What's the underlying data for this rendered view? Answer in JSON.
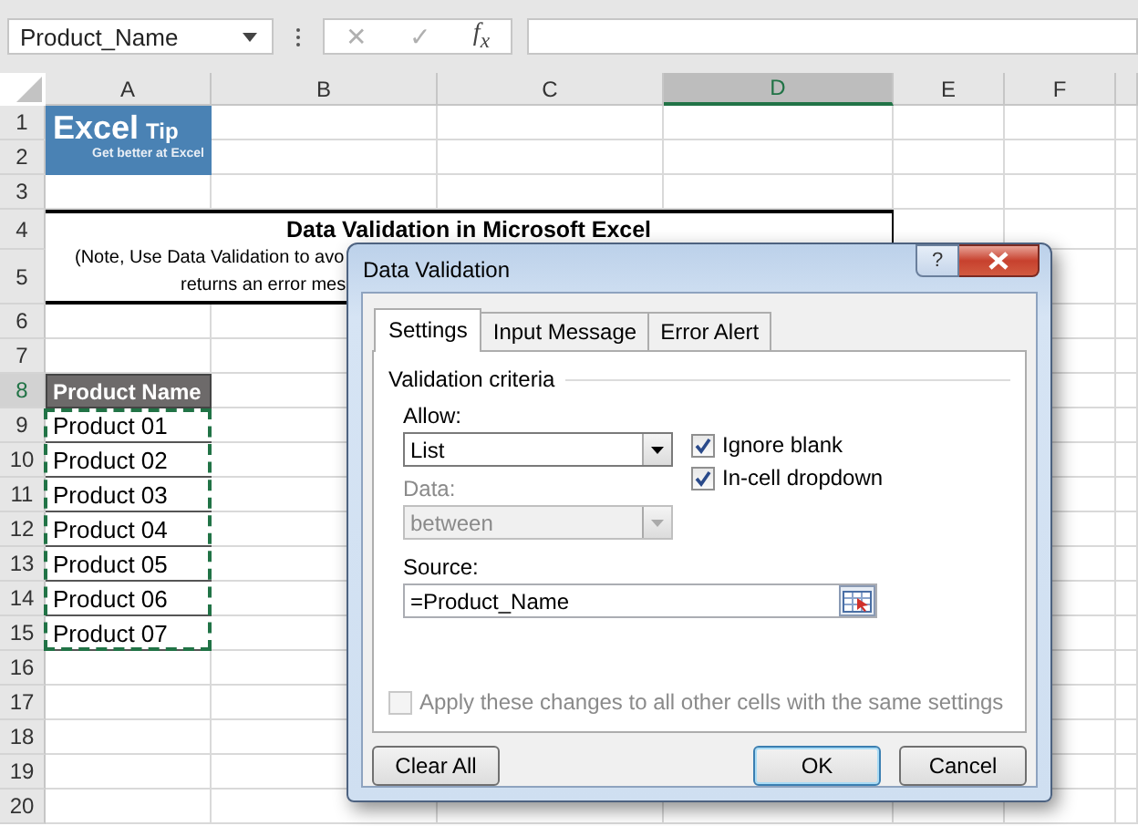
{
  "formula_bar": {
    "name_box": "Product_Name",
    "cancel_symbol": "✕",
    "enter_symbol": "✓",
    "function_label": "f$_{x}$"
  },
  "sheet": {
    "columns": [
      {
        "label": "A",
        "selected": false
      },
      {
        "label": "B",
        "selected": false
      },
      {
        "label": "C",
        "selected": false
      },
      {
        "label": "D",
        "selected": true
      },
      {
        "label": "E",
        "selected": false
      },
      {
        "label": "F",
        "selected": false
      }
    ],
    "rows": [
      {
        "number": "1",
        "selected": false
      },
      {
        "number": "2",
        "selected": false
      },
      {
        "number": "3",
        "selected": false
      },
      {
        "number": "4",
        "selected": false
      },
      {
        "number": "5",
        "selected": false
      },
      {
        "number": "6",
        "selected": false
      },
      {
        "number": "7",
        "selected": false
      },
      {
        "number": "8",
        "selected": true
      },
      {
        "number": "9",
        "selected": false
      },
      {
        "number": "10",
        "selected": false
      },
      {
        "number": "11",
        "selected": false
      },
      {
        "number": "12",
        "selected": false
      },
      {
        "number": "13",
        "selected": false
      },
      {
        "number": "14",
        "selected": false
      },
      {
        "number": "15",
        "selected": false
      },
      {
        "number": "16",
        "selected": false
      },
      {
        "number": "17",
        "selected": false
      },
      {
        "number": "18",
        "selected": false
      },
      {
        "number": "19",
        "selected": false
      },
      {
        "number": "20",
        "selected": false
      }
    ],
    "logo": {
      "title_main": "Excel",
      "title_second": "Tip",
      "tagline": "Get better at Excel"
    },
    "title_block": {
      "heading": "Data Validation in Microsoft Excel",
      "note_lines": [
        "(Note, Use Data Validation to avo",
        "returns an error mes"
      ]
    },
    "table": {
      "header": "Product Name",
      "items": [
        "Product 01",
        "Product 02",
        "Product 03",
        "Product 04",
        "Product 05",
        "Product 06",
        "Product 07"
      ],
      "copy_marquee": true
    }
  },
  "dialog": {
    "title": "Data Validation",
    "help_symbol": "?",
    "tabs": [
      {
        "label": "Settings",
        "selected": true
      },
      {
        "label": "Input Message",
        "selected": false
      },
      {
        "label": "Error Alert",
        "selected": false
      }
    ],
    "group_title": "Validation criteria",
    "allow": {
      "label": "Allow:",
      "value": "List",
      "disabled": false
    },
    "data": {
      "label": "Data:",
      "value": "between",
      "disabled": true
    },
    "checkboxes": [
      {
        "label": "Ignore blank",
        "checked": true,
        "disabled": false
      },
      {
        "label": "In-cell dropdown",
        "checked": true,
        "disabled": false
      }
    ],
    "source": {
      "label": "Source:",
      "value": "=Product_Name"
    },
    "apply_all": {
      "label": "Apply these changes to all other cells with the same settings",
      "checked": false,
      "disabled": true
    },
    "buttons": [
      {
        "label": "Clear All",
        "kind": "secondary"
      },
      {
        "label": "OK",
        "kind": "default"
      },
      {
        "label": "Cancel",
        "kind": "secondary"
      }
    ]
  }
}
